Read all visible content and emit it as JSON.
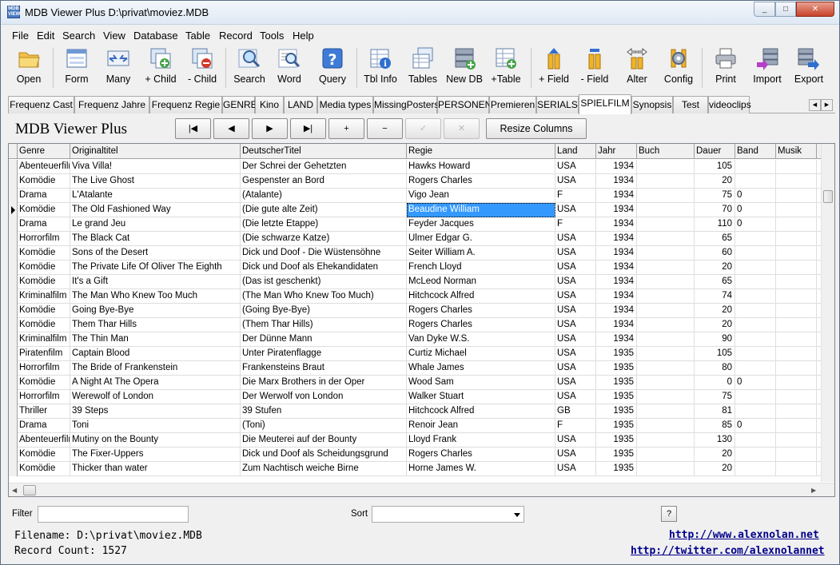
{
  "window": {
    "title": "MDB Viewer Plus D:\\privat\\moviez.MDB",
    "min": "_",
    "max": "□",
    "close": "✕"
  },
  "menu": [
    "File",
    "Edit",
    "Search",
    "View",
    "Database",
    "Table",
    "Record",
    "Tools",
    "Help"
  ],
  "toolbar": [
    {
      "label": "Open",
      "icon": "folder-icon"
    },
    {
      "label": "Form",
      "icon": "form-icon"
    },
    {
      "label": "Many",
      "icon": "many-icon"
    },
    {
      "label": "+ Child",
      "icon": "add-child-icon"
    },
    {
      "label": "- Child",
      "icon": "remove-child-icon"
    },
    {
      "label": "Search",
      "icon": "search-icon"
    },
    {
      "label": "Word",
      "icon": "word-search-icon"
    },
    {
      "label": "Query",
      "icon": "query-icon"
    },
    {
      "label": "Tbl Info",
      "icon": "table-info-icon"
    },
    {
      "label": "Tables",
      "icon": "tables-icon"
    },
    {
      "label": "New DB",
      "icon": "new-db-icon"
    },
    {
      "label": "+Table",
      "icon": "add-table-icon"
    },
    {
      "label": "+ Field",
      "icon": "add-field-icon"
    },
    {
      "label": "- Field",
      "icon": "remove-field-icon"
    },
    {
      "label": "Alter",
      "icon": "alter-icon"
    },
    {
      "label": "Config",
      "icon": "config-icon"
    },
    {
      "label": "Print",
      "icon": "printer-icon"
    },
    {
      "label": "Import",
      "icon": "import-icon"
    },
    {
      "label": "Export",
      "icon": "export-icon"
    }
  ],
  "tabs": [
    "Frequenz Cast",
    "Frequenz Jahre",
    "Frequenz Regie",
    "GENRE",
    "Kino",
    "LAND",
    "Media types",
    "MissingPosters",
    "PERSONEN",
    "Premieren",
    "SERIALS",
    "SPIELFILM",
    "Synopsis",
    "Test",
    "videoclips"
  ],
  "active_tab": "SPIELFILM",
  "app_title": "MDB Viewer Plus",
  "nav": {
    "first": "|◀",
    "prev": "◀",
    "next": "▶",
    "last": "▶|",
    "add": "+",
    "delete": "−",
    "post": "✓",
    "cancel": "✕",
    "resize": "Resize Columns"
  },
  "columns": [
    "Genre",
    "Originaltitel",
    "DeutscherTitel",
    "Regie",
    "Land",
    "Jahr",
    "Buch",
    "Dauer",
    "Band",
    "Musik"
  ],
  "rows": [
    [
      "Abenteuerfilm",
      "Viva Villa!",
      "Der Schrei der Gehetzten",
      "Hawks Howard",
      "USA",
      "1934",
      "",
      "105",
      "",
      ""
    ],
    [
      "Komödie",
      "The Live Ghost",
      "Gespenster an Bord",
      "Rogers Charles",
      "USA",
      "1934",
      "",
      "20",
      "",
      ""
    ],
    [
      "Drama",
      "L'Atalante",
      "(Atalante)",
      "Vigo Jean",
      "F",
      "1934",
      "",
      "75",
      "0",
      ""
    ],
    [
      "Komödie",
      "The Old Fashioned Way",
      "(Die gute alte Zeit)",
      "Beaudine William",
      "USA",
      "1934",
      "",
      "70",
      "0",
      ""
    ],
    [
      "Drama",
      "Le grand Jeu",
      "(Die letzte Etappe)",
      "Feyder Jacques",
      "F",
      "1934",
      "",
      "110",
      "0",
      ""
    ],
    [
      "Horrorfilm",
      "The Black Cat",
      "(Die schwarze Katze)",
      "Ulmer Edgar G.",
      "USA",
      "1934",
      "",
      "65",
      "",
      ""
    ],
    [
      "Komödie",
      "Sons of the Desert",
      "Dick und Doof - Die Wüstensöhne",
      "Seiter William A.",
      "USA",
      "1934",
      "",
      "60",
      "",
      ""
    ],
    [
      "Komödie",
      "The Private Life Of Oliver The Eighth",
      "Dick und Doof als Ehekandidaten",
      "French Lloyd",
      "USA",
      "1934",
      "",
      "20",
      "",
      ""
    ],
    [
      "Komödie",
      "It's a Gift",
      "(Das ist geschenkt)",
      "McLeod Norman",
      "USA",
      "1934",
      "",
      "65",
      "",
      ""
    ],
    [
      "Kriminalfilm",
      "The Man Who Knew Too Much",
      "(The Man Who Knew Too Much)",
      "Hitchcock Alfred",
      "USA",
      "1934",
      "",
      "74",
      "",
      ""
    ],
    [
      "Komödie",
      "Going Bye-Bye",
      "(Going Bye-Bye)",
      "Rogers Charles",
      "USA",
      "1934",
      "",
      "20",
      "",
      ""
    ],
    [
      "Komödie",
      "Them Thar Hills",
      "(Them Thar Hills)",
      "Rogers Charles",
      "USA",
      "1934",
      "",
      "20",
      "",
      ""
    ],
    [
      "Kriminalfilm",
      "The Thin Man",
      "Der Dünne Mann",
      "Van Dyke W.S.",
      "USA",
      "1934",
      "",
      "90",
      "",
      ""
    ],
    [
      "Piratenfilm",
      "Captain Blood",
      "Unter Piratenflagge",
      "Curtiz Michael",
      "USA",
      "1935",
      "",
      "105",
      "",
      ""
    ],
    [
      "Horrorfilm",
      "The Bride of Frankenstein",
      "Frankensteins Braut",
      "Whale James",
      "USA",
      "1935",
      "",
      "80",
      "",
      ""
    ],
    [
      "Komödie",
      "A Night At The Opera",
      "Die Marx Brothers in der Oper",
      "Wood Sam",
      "USA",
      "1935",
      "",
      "0",
      "0",
      ""
    ],
    [
      "Horrorfilm",
      "Werewolf of London",
      "Der Werwolf von London",
      "Walker Stuart",
      "USA",
      "1935",
      "",
      "75",
      "",
      ""
    ],
    [
      "Thriller",
      "39 Steps",
      "39 Stufen",
      "Hitchcock Alfred",
      "GB",
      "1935",
      "",
      "81",
      "",
      ""
    ],
    [
      "Drama",
      "Toni",
      "(Toni)",
      "Renoir Jean",
      "F",
      "1935",
      "",
      "85",
      "0",
      ""
    ],
    [
      "Abenteuerfilm",
      "Mutiny on the Bounty",
      "Die Meuterei auf der Bounty",
      "Lloyd Frank",
      "USA",
      "1935",
      "",
      "130",
      "",
      ""
    ],
    [
      "Komödie",
      "The Fixer-Uppers",
      "Dick und Doof als Scheidungsgrund",
      "Rogers Charles",
      "USA",
      "1935",
      "",
      "20",
      "",
      ""
    ],
    [
      "Komödie",
      "Thicker than water",
      "Zum Nachtisch weiche Birne",
      "Horne James W.",
      "USA",
      "1935",
      "",
      "20",
      "",
      ""
    ]
  ],
  "current_row": 3,
  "current_col": 3,
  "filter": {
    "label": "Filter",
    "value": ""
  },
  "sort": {
    "label": "Sort",
    "value": ""
  },
  "help_button": "?",
  "filename": "Filename: D:\\privat\\moviez.MDB",
  "record_count": "Record Count: 1527",
  "links": {
    "site": "http://www.alexnolan.net",
    "twitter": "http://twitter.com/alexnolannet"
  }
}
